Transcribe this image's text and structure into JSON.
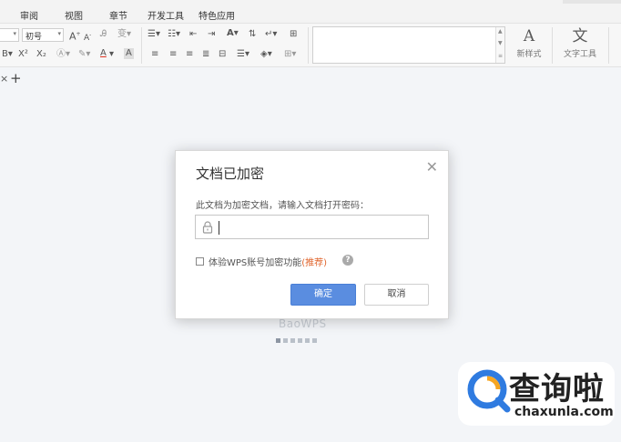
{
  "menubar": {
    "items": [
      "审阅",
      "视图",
      "章节",
      "开发工具",
      "特色应用"
    ]
  },
  "ribbon": {
    "font_size_value": "初号",
    "new_style_label": "新样式",
    "text_tools_label": "文字工具"
  },
  "tabs": {
    "close_glyph": "×",
    "add_glyph": "+"
  },
  "background": {
    "watermark": "BaoWPS"
  },
  "dialog": {
    "title": "文档已加密",
    "prompt": "此文档为加密文档，请输入文档打开密码：",
    "password_value": "",
    "checkbox_label": "体验WPS账号加密功能",
    "checkbox_tag": "(推荐)",
    "checkbox_checked": false,
    "ok_label": "确定",
    "cancel_label": "取消"
  },
  "logo": {
    "cn_text": "查询啦",
    "en_text": "chaxunla.com"
  },
  "colors": {
    "primary_button": "#5a8de0",
    "recommend_text": "#e0652d",
    "logo_blue": "#2f7be0",
    "logo_orange": "#f6a623"
  }
}
